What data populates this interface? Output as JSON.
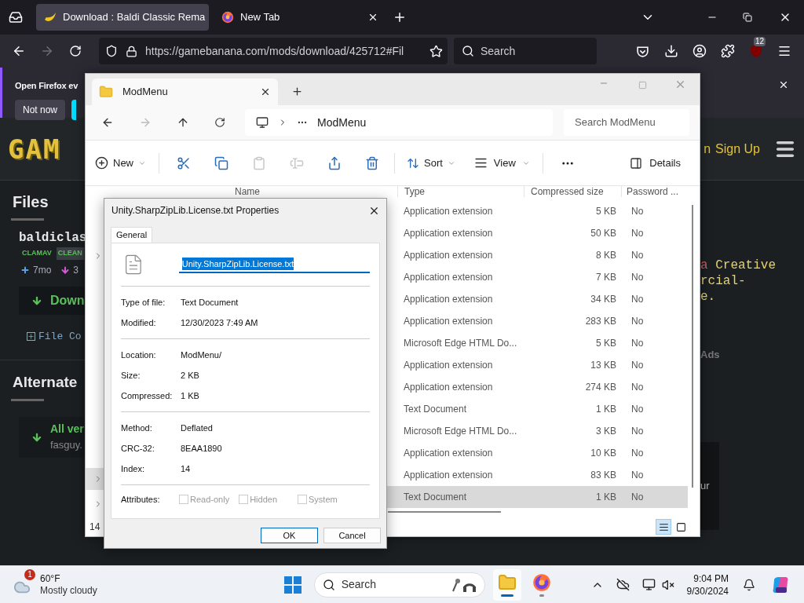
{
  "browser": {
    "tabs": [
      {
        "title": "Download : Baldi Classic Rema",
        "selected": true
      },
      {
        "title": "New Tab",
        "selected": false
      }
    ],
    "url": "https://gamebanana.com/mods/download/425712#Fil",
    "search_placeholder": "Search",
    "extensions_badge": "12"
  },
  "notification": {
    "text": "Open Firefox ev",
    "button": "Not now"
  },
  "site": {
    "logo": "GAM",
    "login_fragment": "n",
    "sign_up": "Sign Up",
    "files_heading": "Files",
    "file_name": "baldiclas",
    "tags": [
      {
        "label": "CLAMAV",
        "kind": "scanner"
      },
      {
        "label": "CLEAN",
        "kind": "result"
      }
    ],
    "meta": [
      {
        "kind": "added",
        "text": "7mo"
      },
      {
        "kind": "downloads",
        "text": "3"
      }
    ],
    "download": "Down",
    "file_contents": "File Co",
    "alternate_heading": "Alternate",
    "alt_title": "All ver",
    "alt_sub": "fasguy.",
    "license_lines": [
      [
        {
          "text": "a",
          "kind": "keyword"
        },
        {
          "text": "Creative",
          "kind": "plain"
        }
      ],
      [
        {
          "text": "rcial-",
          "kind": "plain"
        }
      ],
      [
        {
          "text": "e.",
          "kind": "plain"
        }
      ]
    ],
    "ads": "Ads",
    "side_text": "ur"
  },
  "explorer": {
    "tab": "ModMenu",
    "breadcrumb": "ModMenu",
    "search_placeholder": "Search ModMenu",
    "toolbar": {
      "new": "New",
      "actions": [
        {
          "disabled": false
        },
        {
          "disabled": false
        },
        {
          "disabled": true
        },
        {
          "disabled": true
        },
        {
          "disabled": false
        },
        {
          "disabled": false
        }
      ],
      "sort": "Sort",
      "view": "View",
      "details": "Details"
    },
    "nav_items": [
      {
        "selected": false
      },
      {
        "selected": true
      },
      {
        "selected": false
      }
    ],
    "columns": [
      "Name",
      "Type",
      "Compressed size",
      "Password ..."
    ],
    "rows": [
      {
        "type": "Application extension",
        "size": "5 KB",
        "password": "No",
        "selected": false
      },
      {
        "type": "Application extension",
        "size": "50 KB",
        "password": "No",
        "selected": false
      },
      {
        "type": "Application extension",
        "size": "8 KB",
        "password": "No",
        "selected": false
      },
      {
        "type": "Application extension",
        "size": "7 KB",
        "password": "No",
        "selected": false
      },
      {
        "type": "Application extension",
        "size": "34 KB",
        "password": "No",
        "selected": false
      },
      {
        "type": "Application extension",
        "size": "283 KB",
        "password": "No",
        "selected": false
      },
      {
        "type": "Microsoft Edge HTML Do...",
        "size": "5 KB",
        "password": "No",
        "selected": false
      },
      {
        "type": "Application extension",
        "size": "13 KB",
        "password": "No",
        "selected": false
      },
      {
        "type": "Application extension",
        "size": "274 KB",
        "password": "No",
        "selected": false
      },
      {
        "type": "Text Document",
        "size": "1 KB",
        "password": "No",
        "selected": false
      },
      {
        "type": "Microsoft Edge HTML Do...",
        "size": "3 KB",
        "password": "No",
        "selected": false
      },
      {
        "type": "Application extension",
        "size": "10 KB",
        "password": "No",
        "selected": false
      },
      {
        "type": "Application extension",
        "size": "83 KB",
        "password": "No",
        "selected": false
      },
      {
        "type": "Text Document",
        "size": "1 KB",
        "password": "No",
        "selected": true
      }
    ],
    "status": "14",
    "views": [
      {
        "selected": true
      },
      {
        "selected": false
      }
    ]
  },
  "dialog": {
    "title": "Unity.SharpZipLib.License.txt Properties",
    "tab": "General",
    "file_name": "Unity.SharpZipLib.License.txt",
    "groups": [
      [
        {
          "label": "Type of file:",
          "value": "Text Document"
        },
        {
          "label": "Modified:",
          "value": "12/30/2023 7:49 AM"
        }
      ],
      [
        {
          "label": "Location:",
          "value": "ModMenu/"
        },
        {
          "label": "Size:",
          "value": "2 KB"
        },
        {
          "label": "Compressed:",
          "value": "1 KB"
        }
      ],
      [
        {
          "label": "Method:",
          "value": "Deflated"
        },
        {
          "label": "CRC-32:",
          "value": "8EAA1890"
        },
        {
          "label": "Index:",
          "value": "14"
        }
      ]
    ],
    "attributes_label": "Attributes:",
    "attributes": [
      {
        "label": "Read-only",
        "checked": false
      },
      {
        "label": "Hidden",
        "checked": false
      },
      {
        "label": "System",
        "checked": false
      }
    ],
    "buttons": [
      "OK",
      "Cancel"
    ]
  },
  "taskbar": {
    "weather_badge": "1",
    "temperature": "60°F",
    "condition": "Mostly cloudy",
    "search_placeholder": "Search",
    "apps": [
      {
        "kind": "explorer",
        "active": true
      },
      {
        "kind": "firefox",
        "active": false
      }
    ],
    "time": "9:04 PM",
    "date": "9/30/2024"
  }
}
